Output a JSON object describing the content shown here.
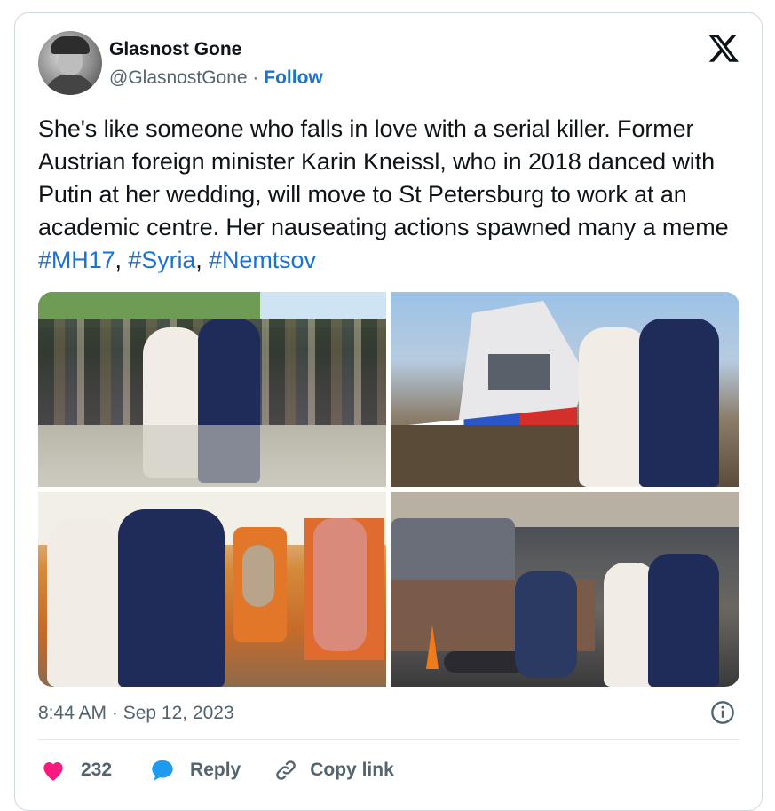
{
  "tweet": {
    "author_name": "Glasnost Gone",
    "handle": "@GlasnostGone",
    "separator": "·",
    "follow_label": "Follow",
    "text_plain": "She's like someone who falls in love with a serial killer. Former Austrian foreign minister Karin Kneissl, who in 2018 danced with Putin at her wedding, will move to St Petersburg to work at an academic centre. Her nauseating actions spawned many a meme",
    "hashtags": [
      "#MH17",
      "#Syria",
      "#Nemtsov"
    ],
    "comma": ",",
    "timestamp": "8:44 AM · Sep 12, 2023",
    "like_count": "232",
    "reply_label": "Reply",
    "copy_link_label": "Copy link"
  },
  "icons": {
    "logo": "x-logo-icon",
    "info": "info-icon",
    "like": "heart-icon",
    "reply": "speech-bubble-icon",
    "copy": "link-icon"
  },
  "colors": {
    "link": "#1d72d0",
    "heart": "#f91880",
    "reply_bubble": "#1d9bf0",
    "muted": "#536471"
  }
}
